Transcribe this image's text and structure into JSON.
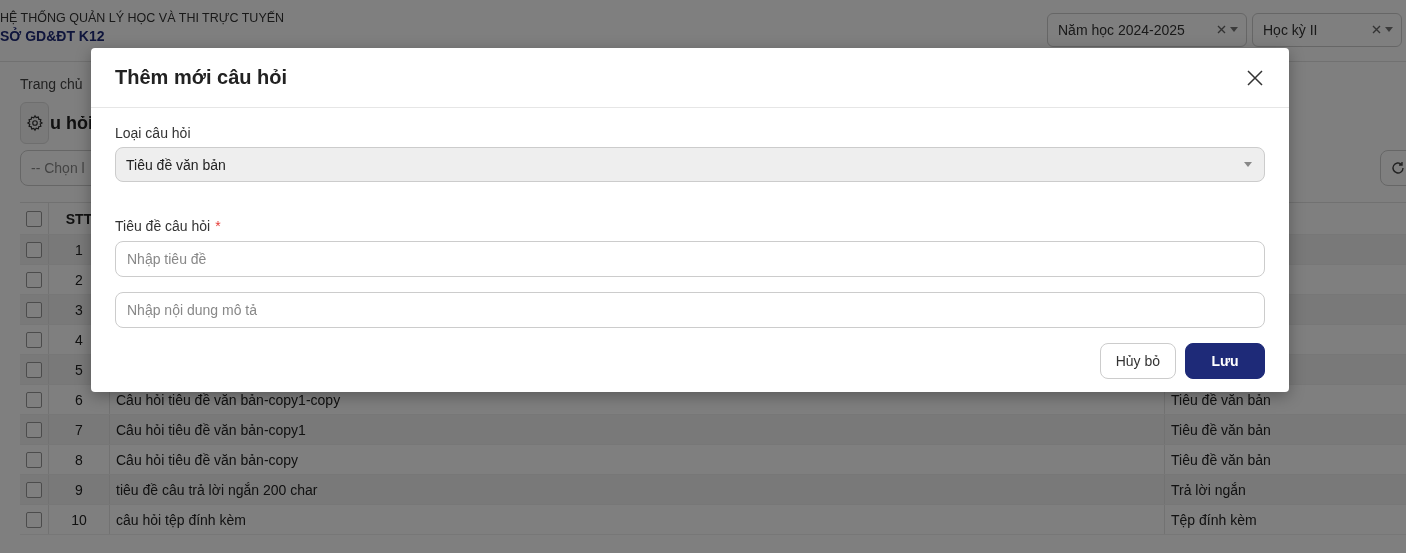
{
  "header": {
    "system_name": "HỆ THỐNG QUẢN LÝ HỌC VÀ THI TRỰC TUYẾN",
    "org_name": "SỞ GD&ĐT K12",
    "selects": [
      {
        "value": "Năm học 2024-2025"
      },
      {
        "value": "Học kỳ II"
      }
    ]
  },
  "breadcrumb": "Trang chủ",
  "page_title": "u hỏi",
  "filter": {
    "placeholder": "-- Chọn l"
  },
  "table": {
    "select_all_checked": false,
    "columns": [
      "STT"
    ],
    "rows": [
      {
        "checked": false,
        "stt": "1"
      },
      {
        "checked": false,
        "stt": "2"
      },
      {
        "checked": false,
        "stt": "3"
      },
      {
        "checked": false,
        "stt": "4"
      },
      {
        "checked": false,
        "stt": "5"
      },
      {
        "checked": false,
        "stt": "6",
        "title": "Câu hỏi tiêu đề văn bản-copy1-copy",
        "type": "Tiêu đề văn bản"
      },
      {
        "checked": false,
        "stt": "7",
        "title": "Câu hỏi tiêu đề văn bản-copy1",
        "type": "Tiêu đề văn bản"
      },
      {
        "checked": false,
        "stt": "8",
        "title": "Câu hỏi tiêu đề văn bản-copy",
        "type": "Tiêu đề văn bản"
      },
      {
        "checked": false,
        "stt": "9",
        "title": "tiêu đề câu trả lời ngắn 200 char",
        "type": "Trả lời ngắn"
      },
      {
        "checked": false,
        "stt": "10",
        "title": "câu hỏi tệp đính kèm",
        "type": "Tệp đính kèm"
      }
    ]
  },
  "dialog": {
    "title": "Thêm mới câu hỏi",
    "type_label": "Loại câu hỏi",
    "type_value": "Tiêu đề văn bản",
    "title_label": "Tiêu đề câu hỏi",
    "title_required": true,
    "required_mark": "*",
    "title_placeholder": "Nhập tiêu đề",
    "description_placeholder": "Nhập nội dung mô tả",
    "buttons": [
      {
        "label": "Hủy bỏ",
        "kind": "secondary"
      },
      {
        "label": "Lưu",
        "kind": "primary"
      }
    ]
  }
}
